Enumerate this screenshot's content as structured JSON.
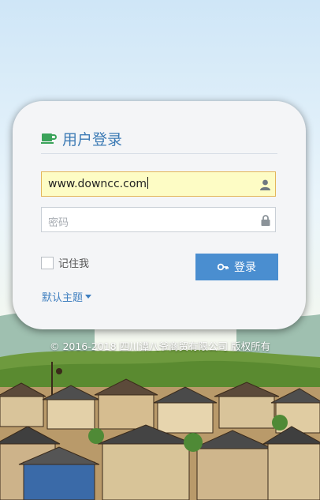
{
  "login": {
    "title": "用户登录",
    "username": {
      "value": "www.downcc.com"
    },
    "password": {
      "placeholder": "密码"
    },
    "remember_label": "记住我",
    "login_button_label": "登录",
    "theme_label": "默认主题"
  },
  "footer": {
    "copyright": "© 2016-2018 四川谭八爷商贸有限公司 版权所有"
  },
  "icons": {
    "title": "coffee-cup-icon",
    "username": "user-icon",
    "password": "lock-icon",
    "login": "key-icon",
    "theme": "caret-down-icon"
  },
  "colors": {
    "accent": "#4a8ed0",
    "title": "#3d7bb5",
    "title_icon": "#3aa35a",
    "active_field_bg": "#fdfcc5"
  }
}
